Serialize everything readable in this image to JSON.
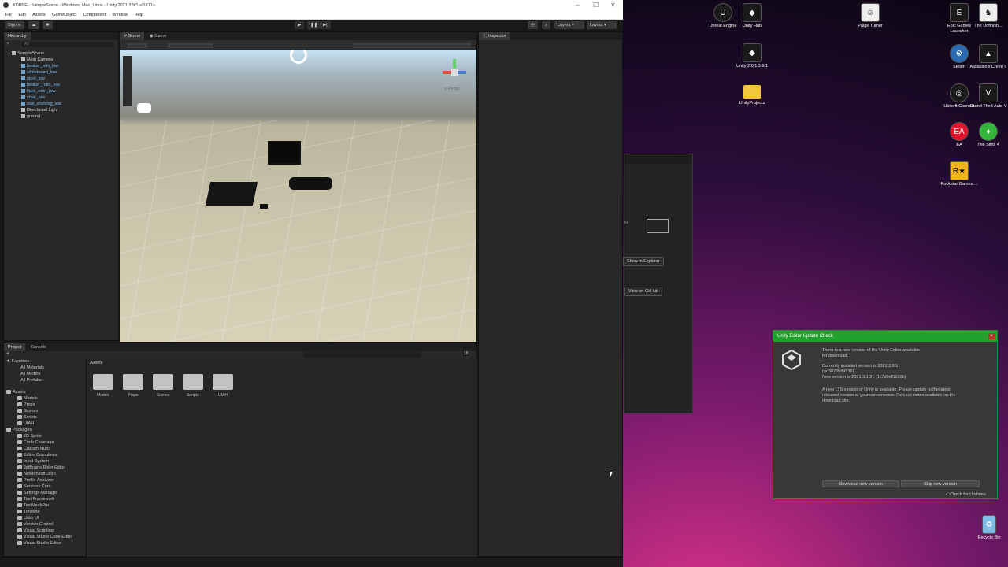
{
  "editor": {
    "window_title": "XDBNF - SampleScene - Windows, Mac, Linux - Unity 2021.3.9f1 <DX11>",
    "menu": [
      "File",
      "Edit",
      "Assets",
      "GameObject",
      "Component",
      "Window",
      "Help"
    ],
    "toolbar": {
      "sign_in": "Sign in",
      "layers": "Layers",
      "layout": "Layout"
    },
    "hierarchy": {
      "tab": "Hierarchy",
      "search_placeholder": "All",
      "scene": "SampleScene",
      "items": [
        "Main Camera",
        "beaker_wiki_low",
        "whiteboard_low",
        "stool_low",
        "beaker_rotin_low",
        "flask_rotin_low",
        "chair_low",
        "wall_shelving_low",
        "Directional Light",
        "ground"
      ]
    },
    "scene_tabs": [
      "Scene",
      "Game"
    ],
    "persp_label": "< Persp",
    "inspector_tab": "Inspector",
    "project": {
      "tabs": [
        "Project",
        "Console"
      ],
      "favorites_label": "Favorites",
      "favorites": [
        "All Materials",
        "All Models",
        "All Prefabs"
      ],
      "assets_label": "Assets",
      "asset_folders": [
        "Models",
        "Props",
        "Scenes",
        "Scripts",
        "UIAH"
      ],
      "packages_label": "Packages",
      "packages": [
        "2D Sprite",
        "Code Coverage",
        "Custom NUnit",
        "Editor Coroutines",
        "Input System",
        "JetBrains Rider Editor",
        "Newtonsoft Json",
        "Profile Analyzer",
        "Services Core",
        "Settings Manager",
        "Test Framework",
        "TextMeshPro",
        "Timeline",
        "Unity UI",
        "Version Control",
        "Visual Scripting",
        "Visual Studio Code Editor",
        "Visual Studio Editor"
      ],
      "breadcrumb": "Assets",
      "badge": "18"
    }
  },
  "desktop": {
    "icons": [
      {
        "label": "Unreal Engine",
        "icon": "unreal-icon"
      },
      {
        "label": "Unity Hub",
        "icon": "unity-hub-icon"
      },
      {
        "label": "Unity 2021.3.9f1",
        "icon": "unity-icon"
      },
      {
        "label": "UnityProjects",
        "icon": "folder-icon"
      },
      {
        "label": "Paige Turner",
        "icon": "user-icon"
      },
      {
        "label": "Epic Games Launcher",
        "icon": "epic-icon"
      },
      {
        "label": "The Unfinish...",
        "icon": "game-icon"
      },
      {
        "label": "Steam",
        "icon": "steam-icon"
      },
      {
        "label": "Assassin's Creed II",
        "icon": "assassin-icon"
      },
      {
        "label": "Ubisoft Connect",
        "icon": "ubisoft-icon"
      },
      {
        "label": "Grand Theft Auto V",
        "icon": "gta-icon"
      },
      {
        "label": "EA",
        "icon": "ea-icon"
      },
      {
        "label": "The Sims 4",
        "icon": "sims-icon"
      },
      {
        "label": "Rockstar Games ...",
        "icon": "rockstar-icon"
      },
      {
        "label": "Recycle Bin",
        "icon": "recycle-bin-icon"
      }
    ],
    "hub_buttons": {
      "show_explorer": "Show in Explorer",
      "view_github": "View on GitHub",
      "partial_label": "for"
    }
  },
  "update_dialog": {
    "title": "Unity Editor Update Check",
    "line1": "There is a new version of the Unity Editor available",
    "line2": "for download.",
    "installed": "Currently installed version is 2021.3.9f1",
    "installed_hash": "(ad3870b89536)",
    "new_version": "New version is 2021.3.10f1 (1c7d0df0160b)",
    "lts1": "A new LTS version of Unity is available. Please update to the latest",
    "lts2": "released version at your convenience. Release notes available on the",
    "lts3": "download site.",
    "download_btn": "Download new version",
    "skip_btn": "Skip new version",
    "check_label": "Check for Updates",
    "check_checked": "true"
  }
}
